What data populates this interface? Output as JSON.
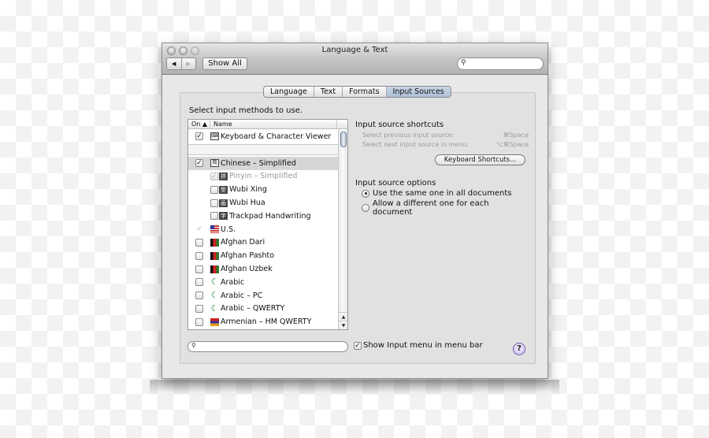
{
  "window": {
    "title": "Language & Text",
    "nav_back": "◀",
    "nav_forward": "▶",
    "show_all": "Show All",
    "search_placeholder": "",
    "search_icon": "🔍"
  },
  "tabs": [
    {
      "label": "Language",
      "active": false
    },
    {
      "label": "Text",
      "active": false
    },
    {
      "label": "Formats",
      "active": false
    },
    {
      "label": "Input Sources",
      "active": true
    }
  ],
  "prompt": "Select input methods to use.",
  "list": {
    "col_on": "On ▲",
    "col_name": "Name",
    "items": [
      {
        "label": "Keyboard & Character Viewer",
        "checked": true,
        "icon": "keyboard-viewer-icon",
        "glyph": "⌨"
      },
      {
        "label": "Chinese – Simplified",
        "checked": true,
        "icon": "chinese-simplified-icon",
        "glyph": "简",
        "selected": true
      },
      {
        "label": "Pinyin – Simplified",
        "checked": true,
        "disabled": true,
        "icon": "pinyin-icon",
        "glyph": "拼"
      },
      {
        "label": "Wubi Xing",
        "checked": false,
        "icon": "wubi-xing-icon",
        "glyph": "型"
      },
      {
        "label": "Wubi Hua",
        "checked": false,
        "icon": "wubi-hua-icon",
        "glyph": "画"
      },
      {
        "label": "Trackpad Handwriting",
        "checked": false,
        "icon": "trackpad-handwriting-icon",
        "glyph": "字"
      },
      {
        "label": "U.S.",
        "checked": true,
        "disabled": true,
        "icon": "us-flag-icon"
      },
      {
        "label": "Afghan Dari",
        "checked": false,
        "icon": "afghan-flag-icon"
      },
      {
        "label": "Afghan Pashto",
        "checked": false,
        "icon": "afghan-flag-icon"
      },
      {
        "label": "Afghan Uzbek",
        "checked": false,
        "icon": "afghan-flag-icon"
      },
      {
        "label": "Arabic",
        "checked": false,
        "icon": "crescent-icon",
        "glyph": "☾"
      },
      {
        "label": "Arabic – PC",
        "checked": false,
        "icon": "crescent-icon",
        "glyph": "☾"
      },
      {
        "label": "Arabic – QWERTY",
        "checked": false,
        "icon": "crescent-icon",
        "glyph": "☾"
      },
      {
        "label": "Armenian – HM QWERTY",
        "checked": false,
        "icon": "armenian-flag-icon"
      }
    ],
    "check_glyph": "✓",
    "scroll_up": "▲",
    "scroll_down": "▼"
  },
  "shortcuts": {
    "heading": "Input source shortcuts",
    "previous_label": "Select previous input source:",
    "previous_key": "⌘Space",
    "next_label": "Select next input source in menu:",
    "next_key": "⌥⌘Space",
    "button": "Keyboard Shortcuts..."
  },
  "options": {
    "heading": "Input source options",
    "same": "Use the same one in all documents",
    "different": "Allow a different one for each document",
    "selected": "same"
  },
  "bottom": {
    "search_placeholder": "",
    "search_icon": "🔍",
    "show_input_menu": "Show Input menu in menu bar",
    "show_input_menu_checked": true,
    "check_glyph": "✓",
    "help": "?"
  }
}
